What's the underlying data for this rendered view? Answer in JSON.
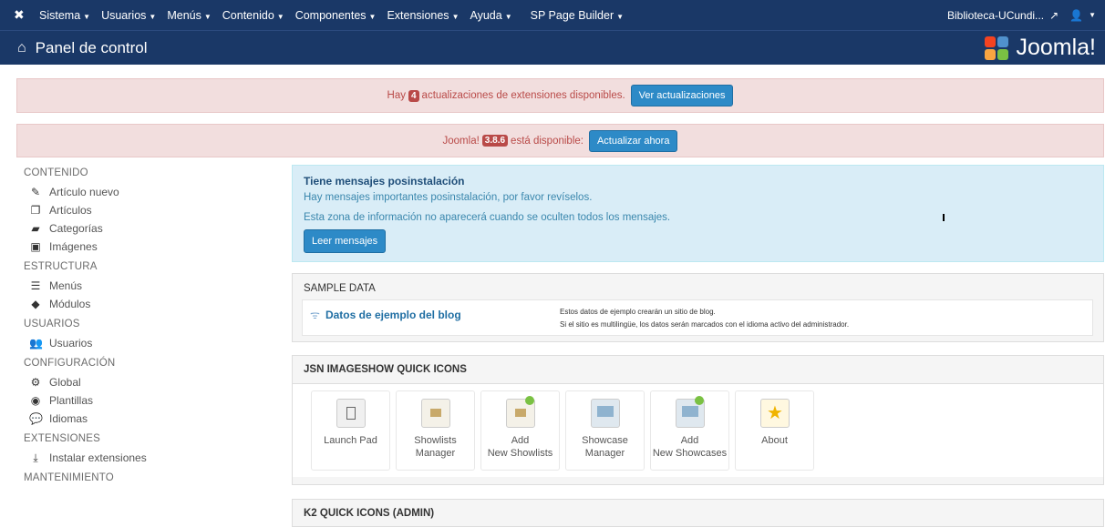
{
  "topbar": {
    "menu": [
      {
        "label": "Sistema"
      },
      {
        "label": "Usuarios"
      },
      {
        "label": "Menús"
      },
      {
        "label": "Contenido"
      },
      {
        "label": "Componentes"
      },
      {
        "label": "Extensiones"
      },
      {
        "label": "Ayuda"
      },
      {
        "label": "SP Page Builder"
      }
    ],
    "site_name": "Biblioteca-UCundi..."
  },
  "header": {
    "title": "Panel de control",
    "brand": "Joomla!"
  },
  "alerts": {
    "updates": {
      "prefix": "Hay",
      "count": "4",
      "suffix": "actualizaciones de extensiones disponibles.",
      "button": "Ver actualizaciones"
    },
    "joomla": {
      "prefix": "Joomla!",
      "version": "3.8.6",
      "suffix": "está disponible:",
      "button": "Actualizar ahora"
    }
  },
  "sidebar": {
    "sections": [
      {
        "title": "CONTENIDO",
        "items": [
          {
            "label": "Artículo nuevo",
            "icon": "pencil-icon"
          },
          {
            "label": "Artículos",
            "icon": "stack-icon"
          },
          {
            "label": "Categorías",
            "icon": "folder-icon"
          },
          {
            "label": "Imágenes",
            "icon": "image-icon"
          }
        ]
      },
      {
        "title": "ESTRUCTURA",
        "items": [
          {
            "label": "Menús",
            "icon": "list-icon"
          },
          {
            "label": "Módulos",
            "icon": "cube-icon"
          }
        ]
      },
      {
        "title": "USUARIOS",
        "items": [
          {
            "label": "Usuarios",
            "icon": "users-icon"
          }
        ]
      },
      {
        "title": "CONFIGURACIÓN",
        "items": [
          {
            "label": "Global",
            "icon": "cog-icon"
          },
          {
            "label": "Plantillas",
            "icon": "eye-icon"
          },
          {
            "label": "Idiomas",
            "icon": "comments-icon"
          }
        ]
      },
      {
        "title": "EXTENSIONES",
        "items": [
          {
            "label": "Instalar extensiones",
            "icon": "upload-icon"
          }
        ]
      },
      {
        "title": "MANTENIMIENTO",
        "items": []
      }
    ]
  },
  "postinstall": {
    "title": "Tiene mensajes posinstalación",
    "line1": "Hay mensajes importantes posinstalación, por favor revíselos.",
    "line2": "Esta zona de información no aparecerá cuando se oculten todos los mensajes.",
    "button": "Leer mensajes"
  },
  "sample_data": {
    "heading": "SAMPLE DATA",
    "item_title": "Datos de ejemplo del blog",
    "desc1": "Estos datos de ejemplo crearán un sitio de blog.",
    "desc2": "Si el sitio es multilingüe, los datos serán marcados con el idioma activo del administrador."
  },
  "jsn": {
    "heading": "JSN IMAGESHOW QUICK ICONS",
    "icons": [
      {
        "label": "Launch Pad"
      },
      {
        "label": "Showlists Manager"
      },
      {
        "label": "Add New Showlists"
      },
      {
        "label": "Showcase Manager"
      },
      {
        "label": "Add New Showcases"
      },
      {
        "label": "About"
      }
    ]
  },
  "k2": {
    "heading": "K2 QUICK ICONS (ADMIN)"
  }
}
